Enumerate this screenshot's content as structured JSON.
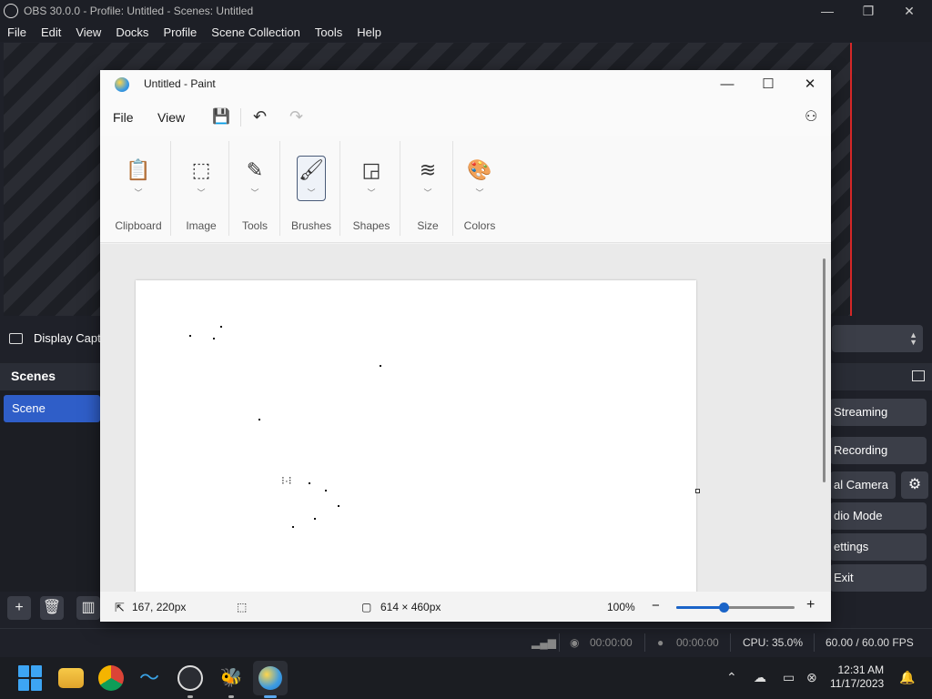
{
  "obs": {
    "window_title": "OBS 30.0.0 - Profile: Untitled - Scenes: Untitled",
    "menu": [
      "File",
      "Edit",
      "View",
      "Docks",
      "Profile",
      "Scene Collection",
      "Tools",
      "Help"
    ],
    "source_label": "Display Capt",
    "scenes_title": "Scenes",
    "scene_item": "Scene",
    "controls": {
      "streaming": "Streaming",
      "recording": "Recording",
      "virtual_camera": "al Camera",
      "studio_mode": "dio Mode",
      "settings": "ettings",
      "exit": "Exit"
    },
    "status": {
      "stream_time": "00:00:00",
      "record_time": "00:00:00",
      "cpu": "CPU: 35.0%",
      "fps": "60.00 / 60.00 FPS"
    },
    "accent": "#2f5ec8"
  },
  "paint": {
    "title": "Untitled - Paint",
    "menu": {
      "file": "File",
      "view": "View"
    },
    "ribbon": [
      "Clipboard",
      "Image",
      "Tools",
      "Brushes",
      "Shapes",
      "Size",
      "Colors"
    ],
    "status": {
      "cursor_pos": "167, 220px",
      "canvas_size": "614 × 460px",
      "zoom": "100%",
      "zoom_level": 0.4
    }
  },
  "taskbar": {
    "time": "12:31 AM",
    "date": "11/17/2023",
    "apps": [
      "windows-start-icon",
      "file-explorer-icon",
      "chrome-icon",
      "edge-dev-icon",
      "obs-icon",
      "bee-app-icon",
      "paint-icon"
    ]
  }
}
